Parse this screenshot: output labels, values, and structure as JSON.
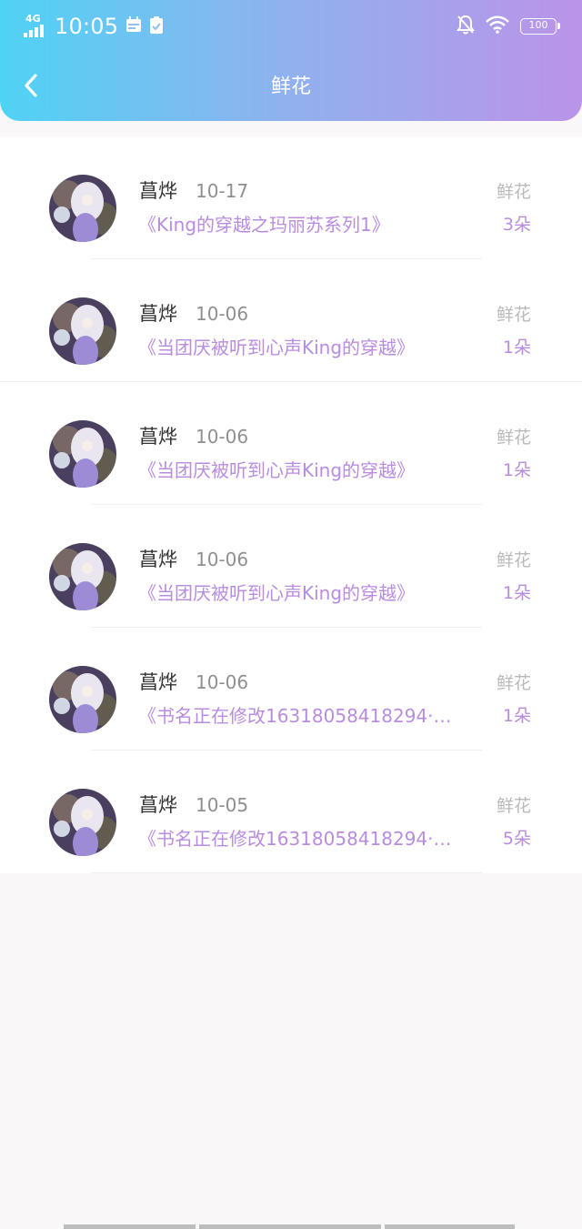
{
  "status_bar": {
    "network": "4G",
    "time": "10:05",
    "battery": "100",
    "icons": [
      "signal-icon",
      "calendar-icon",
      "clipboard-check-icon",
      "bell-off-icon",
      "wifi-icon",
      "battery-icon"
    ]
  },
  "header": {
    "title": "鲜花",
    "back_icon": "chevron-left-icon"
  },
  "records": [
    {
      "user": "菖烨",
      "date": "10-17",
      "book": "《King的穿越之玛丽苏系列1》",
      "label": "鲜花",
      "count": "3朵"
    },
    {
      "user": "菖烨",
      "date": "10-06",
      "book": "《当团厌被听到心声King的穿越》",
      "label": "鲜花",
      "count": "1朵"
    },
    {
      "user": "菖烨",
      "date": "10-06",
      "book": "《当团厌被听到心声King的穿越》",
      "label": "鲜花",
      "count": "1朵"
    },
    {
      "user": "菖烨",
      "date": "10-06",
      "book": "《当团厌被听到心声King的穿越》",
      "label": "鲜花",
      "count": "1朵"
    },
    {
      "user": "菖烨",
      "date": "10-06",
      "book": "《书名正在修改16318058418294·…",
      "label": "鲜花",
      "count": "1朵"
    },
    {
      "user": "菖烨",
      "date": "10-05",
      "book": "《书名正在修改16318058418294·…",
      "label": "鲜花",
      "count": "5朵"
    }
  ],
  "colors": {
    "header_gradient": [
      "#4fd3f5",
      "#8fb2ee",
      "#bb93e8"
    ],
    "accent": "#b98ce0",
    "name_text": "#333333",
    "muted_text": "#8f8f8f",
    "label_text": "#b9b9b9",
    "page_background": "#faf7f8"
  }
}
